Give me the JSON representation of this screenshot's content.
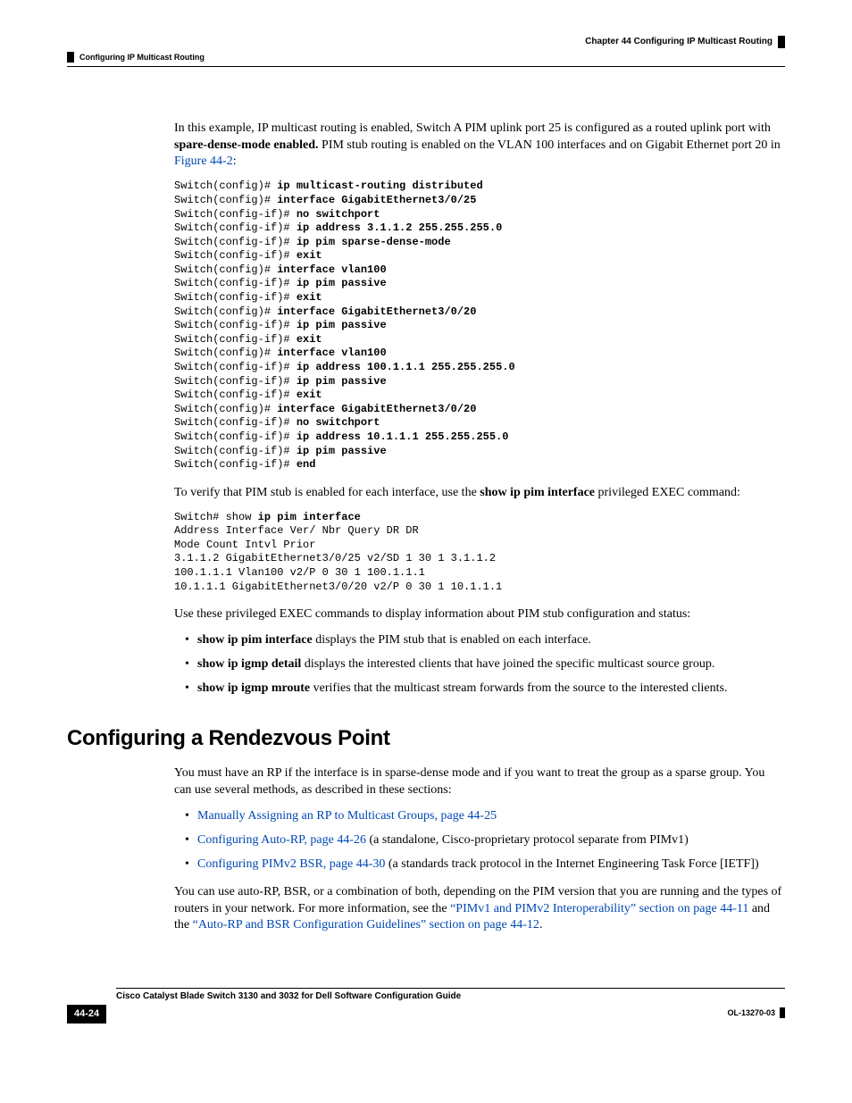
{
  "header": {
    "chapter": "Chapter 44    Configuring IP Multicast Routing",
    "section": "Configuring IP Multicast Routing"
  },
  "body": {
    "para1_pre": "In this example, IP multicast routing is enabled, Switch A PIM uplink port 25 is configured as a routed uplink port with ",
    "para1_bold": "spare-dense-mode enabled.",
    "para1_post": " PIM stub routing is enabled on the VLAN 100 interfaces and on Gigabit Ethernet port 20 in ",
    "para1_link": "Figure 44-2",
    "para1_end": ":",
    "code1": [
      {
        "p": "Switch(config)# ",
        "b": "ip multicast-routing distributed"
      },
      {
        "p": "Switch(config)# ",
        "b": "interface GigabitEthernet3/0/25"
      },
      {
        "p": "Switch(config-if)# ",
        "b": "no switchport"
      },
      {
        "p": "Switch(config-if)# ",
        "b": "ip address 3.1.1.2 255.255.255.0"
      },
      {
        "p": "Switch(config-if)# ",
        "b": "ip pim sparse-dense-mode"
      },
      {
        "p": "Switch(config-if)# ",
        "b": "exit"
      },
      {
        "p": "Switch(config)# ",
        "b": "interface vlan100"
      },
      {
        "p": "Switch(config-if)# ",
        "b": "ip pim passive"
      },
      {
        "p": "Switch(config-if)# ",
        "b": "exit"
      },
      {
        "p": "Switch(config)# ",
        "b": "interface GigabitEthernet3/0/20"
      },
      {
        "p": "Switch(config-if)# ",
        "b": "ip pim passive"
      },
      {
        "p": "Switch(config-if)# ",
        "b": "exit"
      },
      {
        "p": "Switch(config)# ",
        "b": "interface vlan100"
      },
      {
        "p": "Switch(config-if)# ",
        "b": "ip address 100.1.1.1 255.255.255.0"
      },
      {
        "p": "Switch(config-if)# ",
        "b": "ip pim passive"
      },
      {
        "p": "Switch(config-if)# ",
        "b": "exit"
      },
      {
        "p": "Switch(config)# ",
        "b": "interface GigabitEthernet3/0/20"
      },
      {
        "p": "Switch(config-if)# ",
        "b": "no switchport"
      },
      {
        "p": "Switch(config-if)# ",
        "b": "ip address 10.1.1.1 255.255.255.0"
      },
      {
        "p": "Switch(config-if)# ",
        "b": "ip pim passive"
      },
      {
        "p": "Switch(config-if)# ",
        "b": "end"
      }
    ],
    "para2_pre": "To verify that PIM stub is enabled for each interface, use the ",
    "para2_bold": "show ip pim interface",
    "para2_post": " privileged EXEC command:",
    "code2_line1_pre": "Switch# show ",
    "code2_line1_bold": "ip pim interface",
    "code2_rest": "Address Interface Ver/ Nbr Query DR DR\nMode Count Intvl Prior\n3.1.1.2 GigabitEthernet3/0/25 v2/SD 1 30 1 3.1.1.2\n100.1.1.1 Vlan100 v2/P 0 30 1 100.1.1.1\n10.1.1.1 GigabitEthernet3/0/20 v2/P 0 30 1 10.1.1.1",
    "para3": "Use these privileged EXEC commands to display information about PIM stub configuration and status:",
    "bullets1": [
      {
        "bold": "show ip pim interface",
        "text": " displays the PIM stub that is enabled on each interface."
      },
      {
        "bold": "show ip igmp detail",
        "text": " displays the interested clients that have joined the specific multicast source group."
      },
      {
        "bold": "show ip igmp mroute",
        "text": " verifies that the multicast stream forwards from the source to the interested clients."
      }
    ],
    "heading": "Configuring a Rendezvous Point",
    "para4": "You must have an RP if the interface is in sparse-dense mode and if you want to treat the group as a sparse group. You can use several methods, as described in these sections:",
    "bullets2": [
      {
        "link": "Manually Assigning an RP to Multicast Groups, page 44-25",
        "post": ""
      },
      {
        "link": "Configuring Auto-RP, page 44-26",
        "post": " (a standalone, Cisco-proprietary protocol separate from PIMv1)"
      },
      {
        "link": "Configuring PIMv2 BSR, page 44-30",
        "post": " (a standards track protocol in the Internet Engineering Task Force [IETF])"
      }
    ],
    "para5_pre": "You can use auto-RP, BSR, or a combination of both, depending on the PIM version that you are running and the types of routers in your network. For more information, see the ",
    "para5_link1": "“PIMv1 and PIMv2 Interoperability” section on page 44-11",
    "para5_mid": " and the ",
    "para5_link2": "“Auto-RP and BSR Configuration Guidelines” section on page 44-12",
    "para5_end": "."
  },
  "footer": {
    "guide": "Cisco Catalyst Blade Switch 3130 and 3032 for Dell Software Configuration Guide",
    "page": "44-24",
    "docid": "OL-13270-03"
  }
}
